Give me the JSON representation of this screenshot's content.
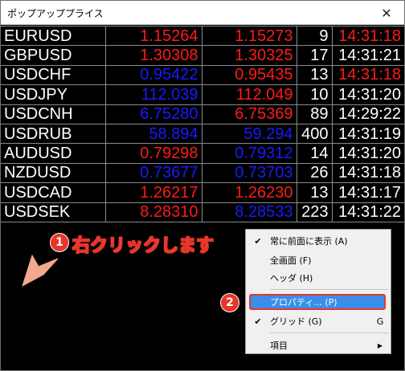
{
  "window": {
    "title": "ポップアッププライス",
    "close_glyph": "✕"
  },
  "quotes": [
    {
      "symbol": "EURUSD",
      "bid": "1.15264",
      "bid_color": "red",
      "ask": "1.15273",
      "ask_color": "red",
      "spread": "9",
      "time": "14:31:18",
      "time_color": "red"
    },
    {
      "symbol": "GBPUSD",
      "bid": "1.30308",
      "bid_color": "red",
      "ask": "1.30325",
      "ask_color": "red",
      "spread": "17",
      "time": "14:31:21",
      "time_color": "white"
    },
    {
      "symbol": "USDCHF",
      "bid": "0.95422",
      "bid_color": "blue",
      "ask": "0.95435",
      "ask_color": "red",
      "spread": "13",
      "time": "14:31:18",
      "time_color": "red"
    },
    {
      "symbol": "USDJPY",
      "bid": "112.039",
      "bid_color": "blue",
      "ask": "112.049",
      "ask_color": "red",
      "spread": "10",
      "time": "14:31:20",
      "time_color": "white"
    },
    {
      "symbol": "USDCNH",
      "bid": "6.75280",
      "bid_color": "blue",
      "ask": "6.75369",
      "ask_color": "red",
      "spread": "89",
      "time": "14:29:22",
      "time_color": "white"
    },
    {
      "symbol": "USDRUB",
      "bid": "58.894",
      "bid_color": "blue",
      "ask": "59.294",
      "ask_color": "blue",
      "spread": "400",
      "time": "14:31:19",
      "time_color": "white"
    },
    {
      "symbol": "AUDUSD",
      "bid": "0.79298",
      "bid_color": "red",
      "ask": "0.79312",
      "ask_color": "blue",
      "spread": "14",
      "time": "14:31:20",
      "time_color": "white"
    },
    {
      "symbol": "NZDUSD",
      "bid": "0.73677",
      "bid_color": "blue",
      "ask": "0.73703",
      "ask_color": "blue",
      "spread": "26",
      "time": "14:31:18",
      "time_color": "white"
    },
    {
      "symbol": "USDCAD",
      "bid": "1.26217",
      "bid_color": "red",
      "ask": "1.26230",
      "ask_color": "red",
      "spread": "13",
      "time": "14:31:17",
      "time_color": "white"
    },
    {
      "symbol": "USDSEK",
      "bid": "8.28310",
      "bid_color": "red",
      "ask": "8.28533",
      "ask_color": "blue",
      "spread": "223",
      "time": "14:31:22",
      "time_color": "white"
    }
  ],
  "annotations": {
    "step1_number": "1",
    "step1_text": "右クリックします",
    "step2_number": "2"
  },
  "context_menu": {
    "items": [
      {
        "label": "常に前面に表示 (A)",
        "checked": true,
        "shortcut": ""
      },
      {
        "label": "全画面 (F)",
        "checked": false,
        "shortcut": ""
      },
      {
        "label": "ヘッダ (H)",
        "checked": false,
        "shortcut": ""
      },
      {
        "label": "プロパティ... (P)",
        "checked": false,
        "shortcut": "",
        "highlighted": true
      },
      {
        "label": "グリッド (G)",
        "checked": true,
        "shortcut": "G"
      },
      {
        "label": "項目",
        "checked": false,
        "submenu": true
      }
    ],
    "check_glyph": "✔",
    "submenu_glyph": "▶"
  },
  "colors": {
    "accent_badge": "#e8362a",
    "menu_highlight": "#3b8ee8",
    "price_up": "#ff1a1a",
    "price_down": "#1a1aff"
  }
}
